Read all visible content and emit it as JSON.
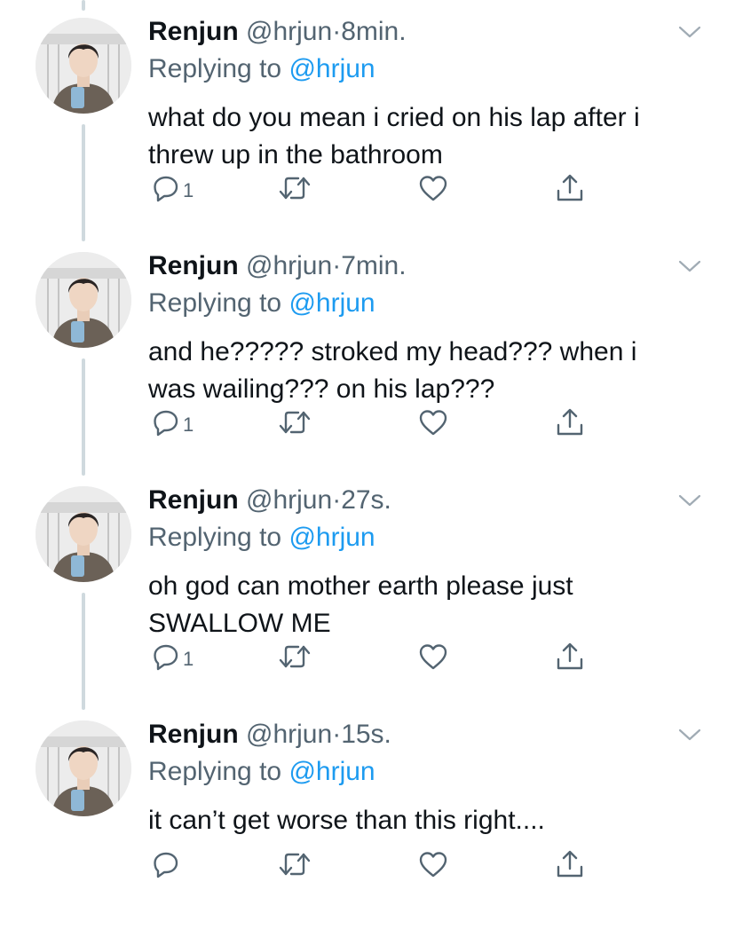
{
  "colors": {
    "accent": "#1d9bf0",
    "secondary_text": "#536471",
    "primary_text": "#0f1419",
    "thread_line": "#cfd9de"
  },
  "icons": {
    "reply": "reply-icon",
    "retweet": "retweet-icon",
    "like": "heart-icon",
    "share": "share-icon",
    "menu": "chevron-down-icon"
  },
  "tweets": [
    {
      "name": "Renjun",
      "handle": "@hrjun",
      "separator": "·",
      "time": "8min.",
      "replying_prefix": "Replying to",
      "replying_to": "@hrjun",
      "text": "what do you mean i cried on his lap after i threw up in the bathroom",
      "reply_count": "1"
    },
    {
      "name": "Renjun",
      "handle": "@hrjun",
      "separator": "·",
      "time": "7min.",
      "replying_prefix": "Replying to",
      "replying_to": "@hrjun",
      "text": "and he????? stroked my head??? when i was wailing??? on his lap???",
      "reply_count": "1"
    },
    {
      "name": "Renjun",
      "handle": "@hrjun",
      "separator": "·",
      "time": "27s.",
      "replying_prefix": "Replying to",
      "replying_to": "@hrjun",
      "text": "oh god can mother earth please just SWALLOW ME",
      "reply_count": "1"
    },
    {
      "name": "Renjun",
      "handle": "@hrjun",
      "separator": "·",
      "time": "15s.",
      "replying_prefix": "Replying to",
      "replying_to": "@hrjun",
      "text": "it can’t get worse than this right....",
      "reply_count": ""
    }
  ]
}
